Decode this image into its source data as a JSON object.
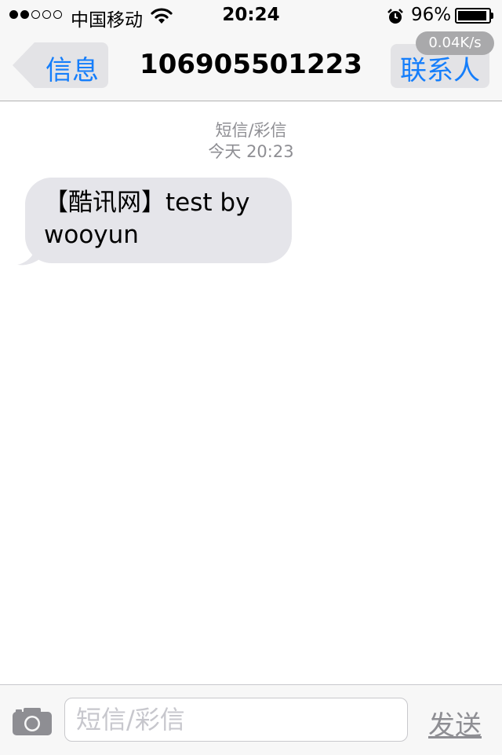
{
  "status_bar": {
    "carrier": "中国移动",
    "time": "20:24",
    "battery_percent": "96%",
    "battery_level": 0.96,
    "signal_bars_filled": 2,
    "signal_bars_total": 5
  },
  "nav": {
    "back_label": "信息",
    "title": "106905501223",
    "contact_label": "联系人",
    "net_speed": "0.04K/s"
  },
  "conversation": {
    "message_type": "短信/彩信",
    "timestamp": "今天 20:23",
    "messages": [
      {
        "direction": "incoming",
        "lines": [
          "【酷讯网】test by",
          "wooyun"
        ]
      }
    ]
  },
  "input": {
    "placeholder": "短信/彩信",
    "value": "",
    "send_label": "发送"
  },
  "colors": {
    "accent": "#157efb",
    "bubble_incoming": "#e5e5ea",
    "bar_background": "#f7f7f7",
    "meta_text": "#8e8e93"
  },
  "icons": [
    "signal-dot",
    "wifi-icon",
    "alarm-icon",
    "battery-icon",
    "back-chevron-icon",
    "camera-icon"
  ]
}
